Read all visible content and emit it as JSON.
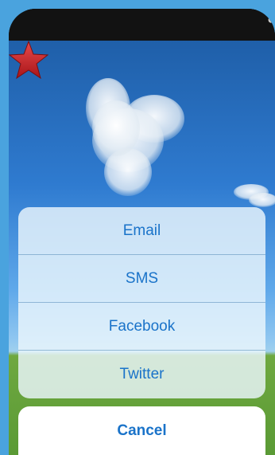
{
  "share_sheet": {
    "items": [
      {
        "label": "Email"
      },
      {
        "label": "SMS"
      },
      {
        "label": "Facebook"
      },
      {
        "label": "Twitter"
      }
    ],
    "cancel_label": "Cancel"
  },
  "colors": {
    "action_text": "#1a73c9",
    "sheet_background": "#ebf6fc",
    "star_fill": "#c8262a",
    "page_background": "#4aa3de"
  },
  "icons": {
    "favorite": "star-icon"
  }
}
